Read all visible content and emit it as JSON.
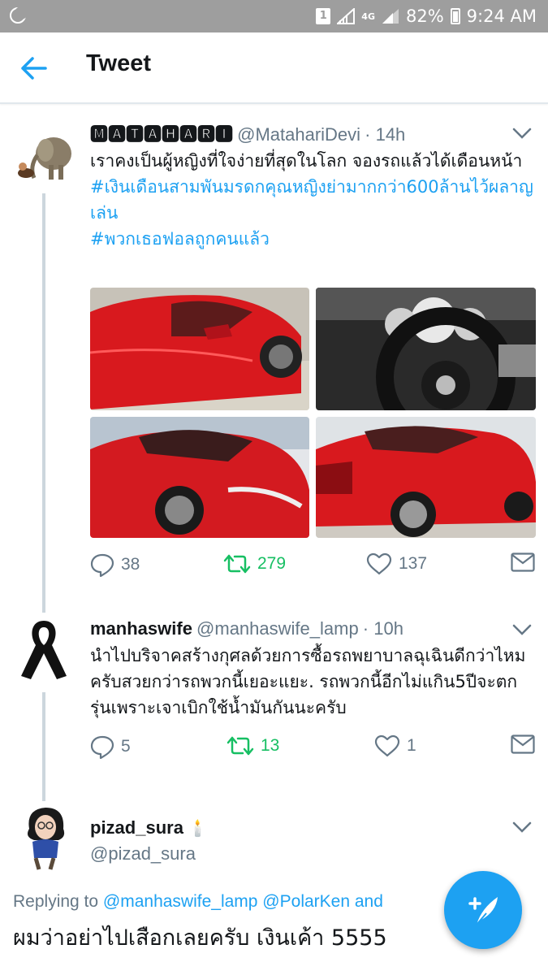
{
  "status_bar": {
    "sim": "1",
    "network": "4G",
    "battery": "82%",
    "time": "9:24 AM"
  },
  "header": {
    "title": "Tweet"
  },
  "tweets": [
    {
      "name": "🅼🅰🆃🅰🅷🅰🆁🅸",
      "handle": "@MatahariDevi",
      "time": "· 14h",
      "text": "เราคงเป็นผู้หญิงที่ใจง่ายที่สุดในโลก จองรถแล้วได้เดือนหน้า",
      "hashtags": [
        "#เงินเดือนสามพันมรดกคุณหญิงย่ามากกว่า600ล้านไว้ผลาญเล่น",
        "#พวกเธอฟอลถูกคนแล้ว"
      ],
      "replies": "38",
      "retweets": "279",
      "likes": "137"
    },
    {
      "name": "manhaswife",
      "handle": "@manhaswife_lamp",
      "time": "· 10h",
      "text": "นำไปบริจาคสร้างกุศลด้วยการซื้อรถพยาบาลฉุเฉินดีกว่าไหมครับสวยกว่ารถพวกนี้เยอะแยะ. รถพวกนี้อีกไม่แกิน5ปีจะตกรุ่นเพราะเจาเบิกใช้น้ำมันกันนะครับ",
      "replies": "5",
      "retweets": "13",
      "likes": "1"
    },
    {
      "name": "pizad_sura",
      "handle": "@pizad_sura",
      "emoji": "🕯️",
      "replying_prefix": "Replying to",
      "replying_to": "@manhaswife_lamp @PolarKen and",
      "text": "ผมว่าอย่าไปเสือกเลยครับ เงินเค้า 5555"
    }
  ],
  "colors": {
    "accent": "#1da1f2",
    "retweet": "#17bf63",
    "muted": "#657786",
    "status_bar": "#9e9e9e",
    "car_red": "#d8191e"
  }
}
